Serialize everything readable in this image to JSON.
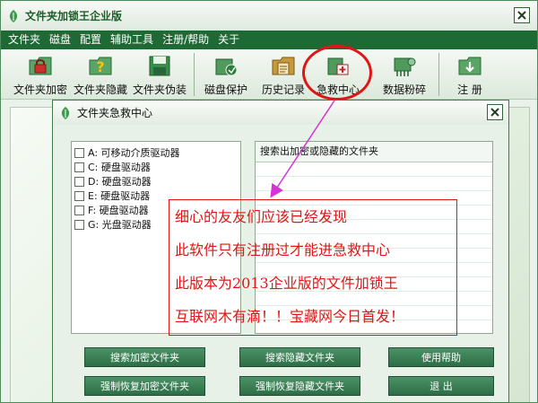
{
  "app": {
    "title": "文件夹加锁王企业版"
  },
  "menu": [
    "文件夹",
    "磁盘",
    "配置",
    "辅助工具",
    "注册/帮助",
    "关于"
  ],
  "toolbar": [
    {
      "label": "文件夹加密",
      "icon": "folder-encrypt-icon"
    },
    {
      "label": "文件夹隐藏",
      "icon": "folder-hide-icon"
    },
    {
      "label": "文件夹伪装",
      "icon": "folder-disguise-icon"
    },
    {
      "label": "磁盘保护",
      "icon": "disk-protect-icon"
    },
    {
      "label": "历史记录",
      "icon": "history-icon"
    },
    {
      "label": "急救中心",
      "icon": "rescue-center-icon"
    },
    {
      "label": "数据粉碎",
      "icon": "data-shred-icon"
    },
    {
      "label": "注  册",
      "icon": "register-icon"
    }
  ],
  "dialog": {
    "title": "文件夹急救中心",
    "drives": [
      "A: 可移动介质驱动器",
      "C: 硬盘驱动器",
      "D: 硬盘驱动器",
      "E: 硬盘驱动器",
      "F: 硬盘驱动器",
      "G: 光盘驱动器"
    ],
    "result_header": "搜索出加密或隐藏的文件夹",
    "buttons": {
      "search_encrypted": "搜索加密文件夹",
      "search_hidden": "搜索隐藏文件夹",
      "help": "使用帮助",
      "force_restore_encrypted": "强制恢复加密文件夹",
      "force_restore_hidden": "强制恢复隐藏文件夹",
      "exit": "退    出"
    }
  },
  "annotation": {
    "lines": [
      "细心的友友们应该已经发现",
      "此软件只有注册过才能进急救中心",
      "此版本为2013企业版的文件加锁王",
      "互联网木有滴！！宝藏网今日首发！"
    ],
    "color": "#e01515"
  },
  "colors": {
    "menu_bar": "#1d6a35",
    "accent_green": "#2d6e46",
    "annotation_red": "#e01515"
  }
}
